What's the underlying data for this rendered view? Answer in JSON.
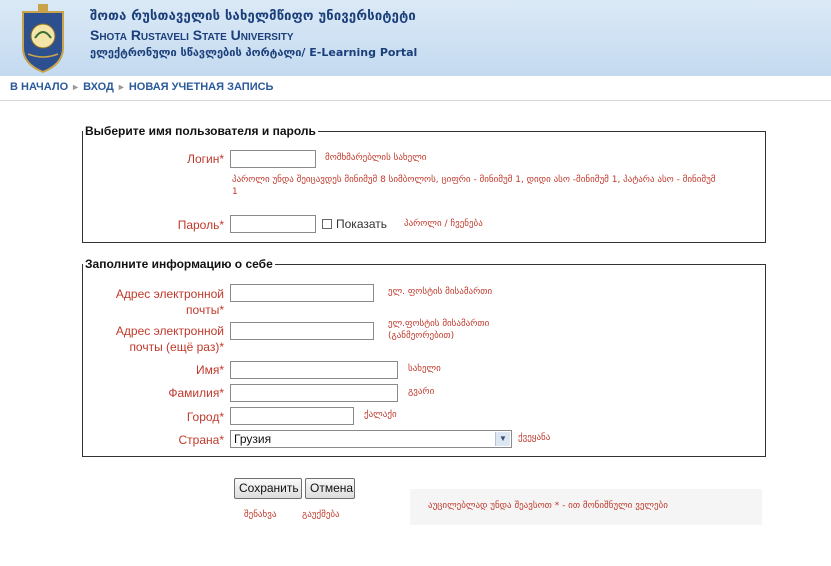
{
  "header": {
    "title_geo": "შოთა რუსთაველის სახელმწიფო უნივერსიტეტი",
    "title_eng": "Shota Rustaveli State University",
    "portal": "ელექტრონული სწავლების პორტალი/ E-Learning Portal"
  },
  "breadcrumb": {
    "items": [
      "В НАЧАЛО",
      "ВХОД",
      "НОВАЯ УЧЕТНАЯ ЗАПИСЬ"
    ],
    "separator": "►"
  },
  "section_login": {
    "legend": "Выберите имя пользователя и пароль",
    "username_label": "Логин",
    "username_value": "",
    "username_hint": "მომხმარებლის სახელი",
    "password_rule": "პაროლი უნდა შეიცავდეს მინიმუმ 8 სიმბოლოს, ციფრი - მინიმუმ 1, დიდი ასო -მინიმუმ 1, პატარა ასო - მინიმუმ 1",
    "password_label": "Пароль",
    "password_value": "",
    "show_label": "Показать",
    "password_hint": "პაროლი / ჩვენება"
  },
  "section_profile": {
    "legend": "Заполните информацию о себе",
    "email_label": "Адрес электронной почты",
    "email_hint": "ელ. ფოსტის მისამართი",
    "email2_label": "Адрес электронной почты (ещё раз)",
    "email2_hint": "ელ.ფოსტის მისამართი (განმეორებით)",
    "firstname_label": "Имя",
    "firstname_hint": "სახელი",
    "lastname_label": "Фамилия",
    "lastname_hint": "გვარი",
    "city_label": "Город",
    "city_hint": "ქალაქი",
    "country_label": "Страна",
    "country_value": "Грузия",
    "country_hint": "ქვეყანა"
  },
  "buttons": {
    "save": "Сохранить",
    "cancel": "Отмена",
    "save_hint": "შენახვა",
    "cancel_hint": "გაუქმება"
  },
  "required_asterisk": "*",
  "required_note": "აუცილებლად უნდა შეავსოთ * - ით მონიშნული ველები",
  "colors": {
    "required_red": "#c0392b",
    "header_blue": "#1b3f7a",
    "link_blue": "#2a5a9a"
  }
}
